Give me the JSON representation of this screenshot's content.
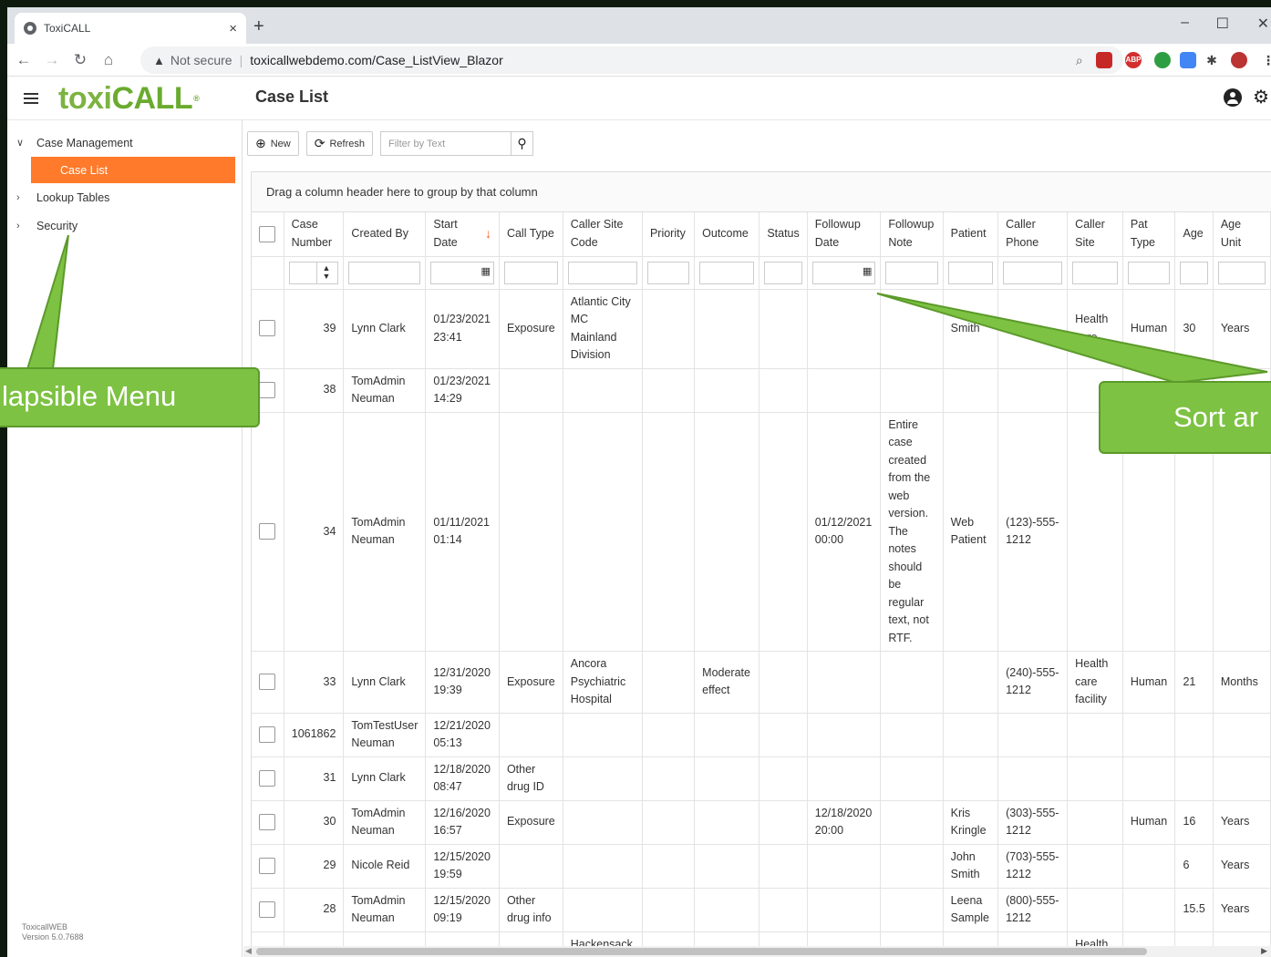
{
  "browser": {
    "tab_title": "ToxiCALL",
    "tab_close": "×",
    "new_tab": "+",
    "not_secure": "Not secure",
    "url": "toxicallwebdemo.com/Case_ListView_Blazor",
    "win_min": "–",
    "win_max": "☐",
    "win_close": "✕"
  },
  "app": {
    "logo_a": "toxi",
    "logo_b": "CALL",
    "page_title": "Case List"
  },
  "sidebar": {
    "items": [
      {
        "label": "Case Management",
        "chev": "∨"
      },
      {
        "label": "Case List"
      },
      {
        "label": "Lookup Tables",
        "chev": "›"
      },
      {
        "label": "Security",
        "chev": "›"
      }
    ],
    "version_line1": "ToxicallWEB",
    "version_line2": "Version 5.0.7688"
  },
  "toolbar": {
    "new_label": "New",
    "refresh_label": "Refresh",
    "filter_placeholder": "Filter by Text"
  },
  "group_hint": "Drag a column header here to group by that column",
  "columns": [
    {
      "label": "Case Number"
    },
    {
      "label": "Created By"
    },
    {
      "label": "Start Date",
      "sorted": "desc"
    },
    {
      "label": "Call Type"
    },
    {
      "label": "Caller Site Code"
    },
    {
      "label": "Priority"
    },
    {
      "label": "Outcome"
    },
    {
      "label": "Status"
    },
    {
      "label": "Followup Date"
    },
    {
      "label": "Followup Note"
    },
    {
      "label": "Patient"
    },
    {
      "label": "Caller Phone"
    },
    {
      "label": "Caller Site"
    },
    {
      "label": "Pat Type"
    },
    {
      "label": "Age"
    },
    {
      "label": "Age Unit"
    }
  ],
  "rows": [
    {
      "case": "39",
      "created": "Lynn Clark",
      "start": "01/23/2021 23:41",
      "calltype": "Exposure",
      "sitecode": "Atlantic City MC Mainland Division",
      "priority": "",
      "outcome": "",
      "status": "",
      "fdate": "",
      "fnote": "",
      "patient": "Smith",
      "phone": "",
      "site": "Health care",
      "pattype": "Human",
      "age": "30",
      "ageunit": "Years"
    },
    {
      "case": "38",
      "created": "TomAdmin Neuman",
      "start": "01/23/2021 14:29",
      "calltype": "",
      "sitecode": "",
      "priority": "",
      "outcome": "",
      "status": "",
      "fdate": "",
      "fnote": "",
      "patient": "",
      "phone": "",
      "site": "",
      "pattype": "",
      "age": "",
      "ageunit": ""
    },
    {
      "case": "34",
      "created": "TomAdmin Neuman",
      "start": "01/11/2021 01:14",
      "calltype": "",
      "sitecode": "",
      "priority": "",
      "outcome": "",
      "status": "",
      "fdate": "01/12/2021 00:00",
      "fnote": "Entire case created from the web version. The notes should be regular text, not RTF.",
      "patient": "Web Patient",
      "phone": "(123)-555-1212",
      "site": "",
      "pattype": "",
      "age": "",
      "ageunit": ""
    },
    {
      "case": "33",
      "created": "Lynn Clark",
      "start": "12/31/2020 19:39",
      "calltype": "Exposure",
      "sitecode": "Ancora Psychiatric Hospital",
      "priority": "",
      "outcome": "Moderate effect",
      "status": "",
      "fdate": "",
      "fnote": "",
      "patient": "",
      "phone": "(240)-555-1212",
      "site": "Health care facility",
      "pattype": "Human",
      "age": "21",
      "ageunit": "Months"
    },
    {
      "case": "1061862",
      "created": "TomTestUser Neuman",
      "start": "12/21/2020 05:13",
      "calltype": "",
      "sitecode": "",
      "priority": "",
      "outcome": "",
      "status": "",
      "fdate": "",
      "fnote": "",
      "patient": "",
      "phone": "",
      "site": "",
      "pattype": "",
      "age": "",
      "ageunit": ""
    },
    {
      "case": "31",
      "created": "Lynn Clark",
      "start": "12/18/2020 08:47",
      "calltype": "Other drug ID",
      "sitecode": "",
      "priority": "",
      "outcome": "",
      "status": "",
      "fdate": "",
      "fnote": "",
      "patient": "",
      "phone": "",
      "site": "",
      "pattype": "",
      "age": "",
      "ageunit": ""
    },
    {
      "case": "30",
      "created": "TomAdmin Neuman",
      "start": "12/16/2020 16:57",
      "calltype": "Exposure",
      "sitecode": "",
      "priority": "",
      "outcome": "",
      "status": "",
      "fdate": "12/18/2020 20:00",
      "fnote": "",
      "patient": "Kris Kringle",
      "phone": "(303)-555-1212",
      "site": "",
      "pattype": "Human",
      "age": "16",
      "ageunit": "Years"
    },
    {
      "case": "29",
      "created": "Nicole Reid",
      "start": "12/15/2020 19:59",
      "calltype": "",
      "sitecode": "",
      "priority": "",
      "outcome": "",
      "status": "",
      "fdate": "",
      "fnote": "",
      "patient": "John Smith",
      "phone": "(703)-555-1212",
      "site": "",
      "pattype": "",
      "age": "6",
      "ageunit": "Years"
    },
    {
      "case": "28",
      "created": "TomAdmin Neuman",
      "start": "12/15/2020 09:19",
      "calltype": "Other drug info",
      "sitecode": "",
      "priority": "",
      "outcome": "",
      "status": "",
      "fdate": "",
      "fnote": "",
      "patient": "Leena Sample",
      "phone": "(800)-555-1212",
      "site": "",
      "pattype": "",
      "age": "15.5",
      "ageunit": "Years"
    },
    {
      "case": "",
      "created": "",
      "start": "",
      "calltype": "",
      "sitecode": "Hackensack",
      "priority": "",
      "outcome": "",
      "status": "",
      "fdate": "",
      "fnote": "",
      "patient": "",
      "phone": "",
      "site": "Health",
      "pattype": "",
      "age": "",
      "ageunit": ""
    }
  ],
  "callouts": {
    "left": "lapsible Menu",
    "right": "Sort ar"
  }
}
